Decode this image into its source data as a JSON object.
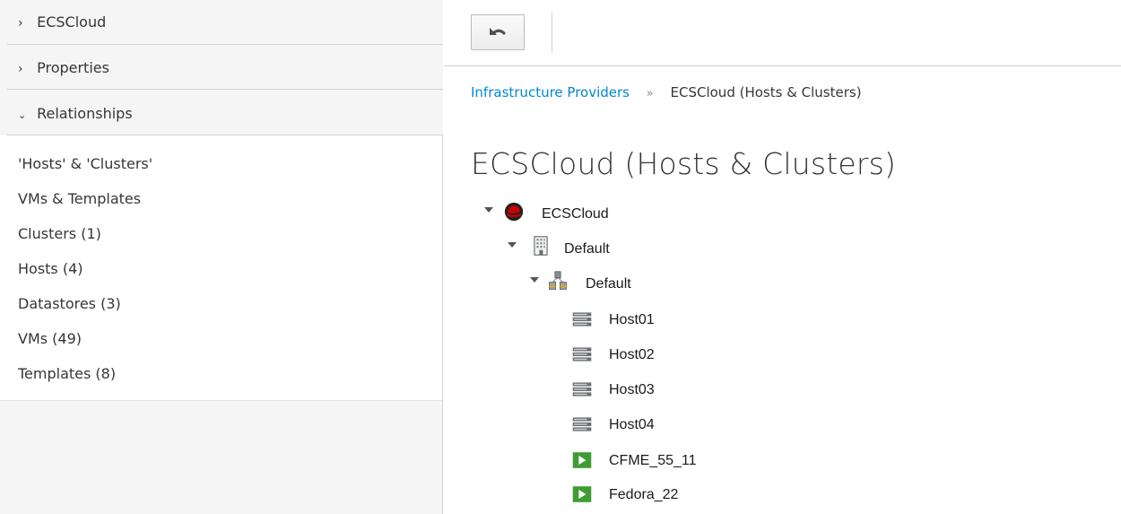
{
  "sidebar": {
    "accordions": [
      {
        "label": "ECSCloud",
        "expanded": false
      },
      {
        "label": "Properties",
        "expanded": false
      },
      {
        "label": "Relationships",
        "expanded": true
      }
    ],
    "relationships": [
      "'Hosts' & 'Clusters'",
      "VMs & Templates",
      "Clusters (1)",
      "Hosts (4)",
      "Datastores (3)",
      "VMs (49)",
      "Templates (8)"
    ]
  },
  "toolbar": {
    "back_icon": "undo-arrow-icon"
  },
  "breadcrumb": {
    "parent": "Infrastructure Providers",
    "separator": "»",
    "current": "ECSCloud (Hosts & Clusters)"
  },
  "page_title": "ECSCloud (Hosts & Clusters)",
  "tree": [
    {
      "label": "ECSCloud",
      "icon": "redhat-provider-icon",
      "expanded": true
    },
    {
      "label": "Default",
      "icon": "datacenter-icon",
      "expanded": true
    },
    {
      "label": "Default",
      "icon": "cluster-icon",
      "expanded": true
    },
    {
      "label": "Host01",
      "icon": "host-server-icon"
    },
    {
      "label": "Host02",
      "icon": "host-server-icon"
    },
    {
      "label": "Host03",
      "icon": "host-server-icon"
    },
    {
      "label": "Host04",
      "icon": "host-server-icon"
    },
    {
      "label": "CFME_55_11",
      "icon": "vm-running-icon"
    },
    {
      "label": "Fedora_22",
      "icon": "vm-running-icon"
    }
  ],
  "colors": {
    "link": "#0088ce",
    "sidebar_bg": "#f5f5f5",
    "vm_running": "#3f9c35"
  }
}
